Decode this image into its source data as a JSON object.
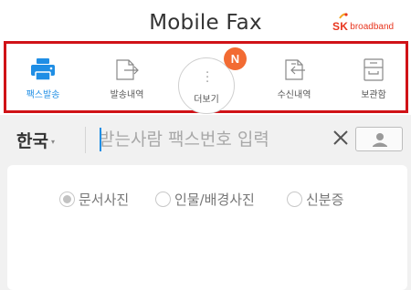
{
  "header": {
    "title": "Mobile Fax",
    "logo_brand": "SK",
    "logo_sub": "broadband"
  },
  "nav": {
    "items": [
      {
        "label": "팩스발송",
        "icon": "fax-machine-icon",
        "active": true
      },
      {
        "label": "발송내역",
        "icon": "sent-history-icon",
        "active": false
      },
      {
        "label": "더보기",
        "icon": "more-vertical-icon",
        "active": false
      },
      {
        "label": "수신내역",
        "icon": "received-history-icon",
        "active": false
      },
      {
        "label": "보관함",
        "icon": "archive-box-icon",
        "active": false
      }
    ],
    "badge": "N"
  },
  "recipient": {
    "country": "한국",
    "placeholder": "받는사람 팩스번호 입력"
  },
  "radio_options": [
    {
      "label": "문서사진",
      "checked": true
    },
    {
      "label": "인물/배경사진",
      "checked": false
    },
    {
      "label": "신분증",
      "checked": false
    }
  ],
  "colors": {
    "accent": "#1f8ee5",
    "highlight_border": "#d01217",
    "badge": "#f26b33",
    "brand": "#e8361f"
  }
}
